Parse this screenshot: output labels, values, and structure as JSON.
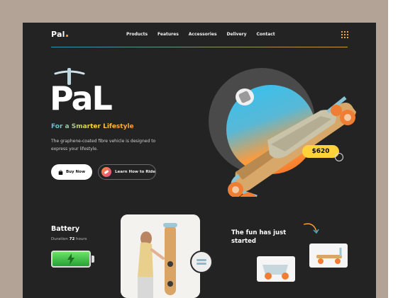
{
  "logo": {
    "text": "Pal"
  },
  "nav": {
    "items": [
      "Products",
      "Features",
      "Accessories",
      "Delivery",
      "Contact"
    ]
  },
  "hero": {
    "title": "PaL",
    "tagline": "For a Smarter Lifestyle",
    "description": "The graphene-coated fibre vehicle is designed to express your lifestyle.",
    "buy_label": "Buy Now",
    "learn_label": "Learn How to Ride",
    "price": "$620"
  },
  "battery": {
    "title": "Battery",
    "duration_label": "Duration",
    "duration_value": "72",
    "duration_unit": "hours"
  },
  "promo": {
    "text": "The fun has just started"
  },
  "colors": {
    "background": "#232323",
    "frame": "#b3a397",
    "accent_yellow": "#ffd23b",
    "accent_orange": "#f28b2b",
    "accent_blue": "#33c2f1",
    "battery_green": "#3ec13f"
  }
}
